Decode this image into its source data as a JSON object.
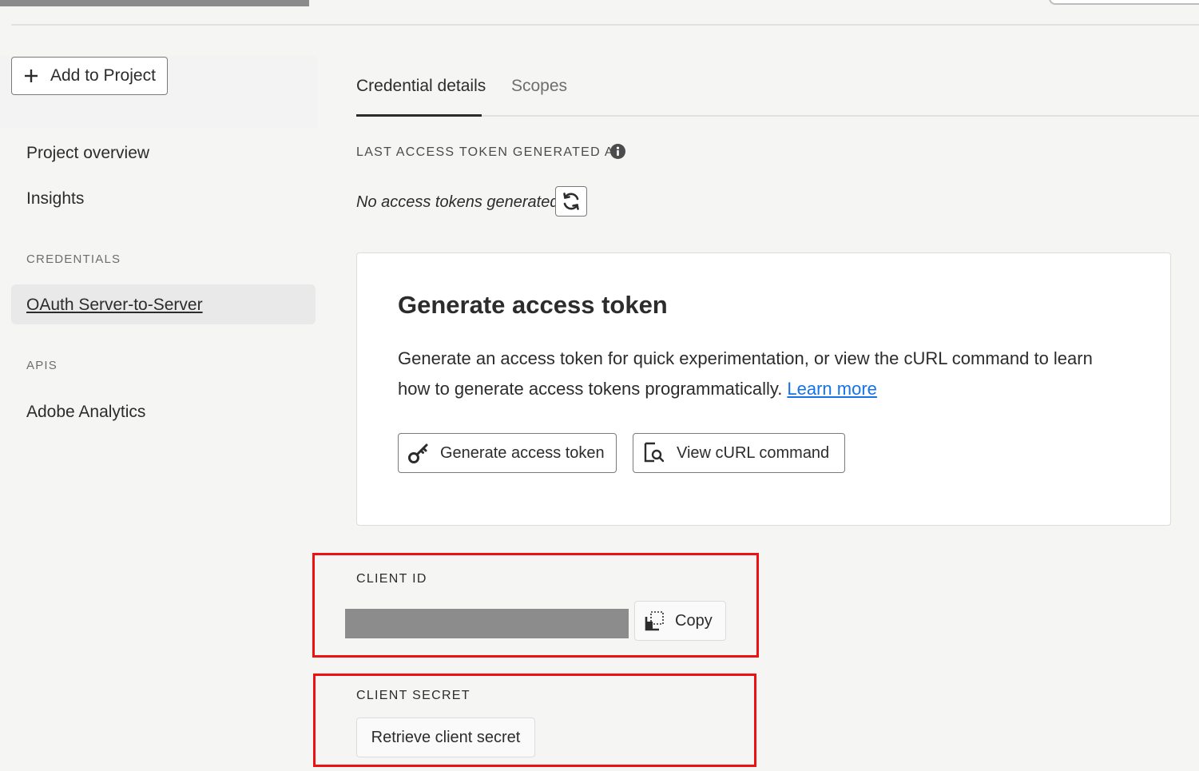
{
  "sidebar": {
    "add_button_label": "Add to Project",
    "nav_items": [
      "Project overview",
      "Insights"
    ],
    "credentials_heading": "CREDENTIALS",
    "selected_credential": "OAuth Server-to-Server",
    "apis_heading": "APIS",
    "api_items": [
      "Adobe Analytics"
    ]
  },
  "tabs": [
    {
      "label": "Credential details",
      "active": true
    },
    {
      "label": "Scopes",
      "active": false
    }
  ],
  "token_status": {
    "label": "LAST ACCESS TOKEN GENERATED AT",
    "value": "No access tokens generated"
  },
  "generate_card": {
    "title": "Generate access token",
    "description": "Generate an access token for quick experimentation, or view the cURL command to learn how to generate access tokens programmatically.",
    "learn_more": "Learn more",
    "generate_button": "Generate access token",
    "curl_button": "View cURL command"
  },
  "client_id": {
    "label": "CLIENT ID",
    "copy_button": "Copy"
  },
  "client_secret": {
    "label": "CLIENT SECRET",
    "retrieve_button": "Retrieve client secret"
  },
  "colors": {
    "accent_link": "#1473e6",
    "highlight_box": "#ee1111",
    "background": "#f5f5f4"
  },
  "icons": [
    "plus-icon",
    "info-icon",
    "refresh-icon",
    "key-icon",
    "search-document-icon",
    "copy-icon"
  ]
}
